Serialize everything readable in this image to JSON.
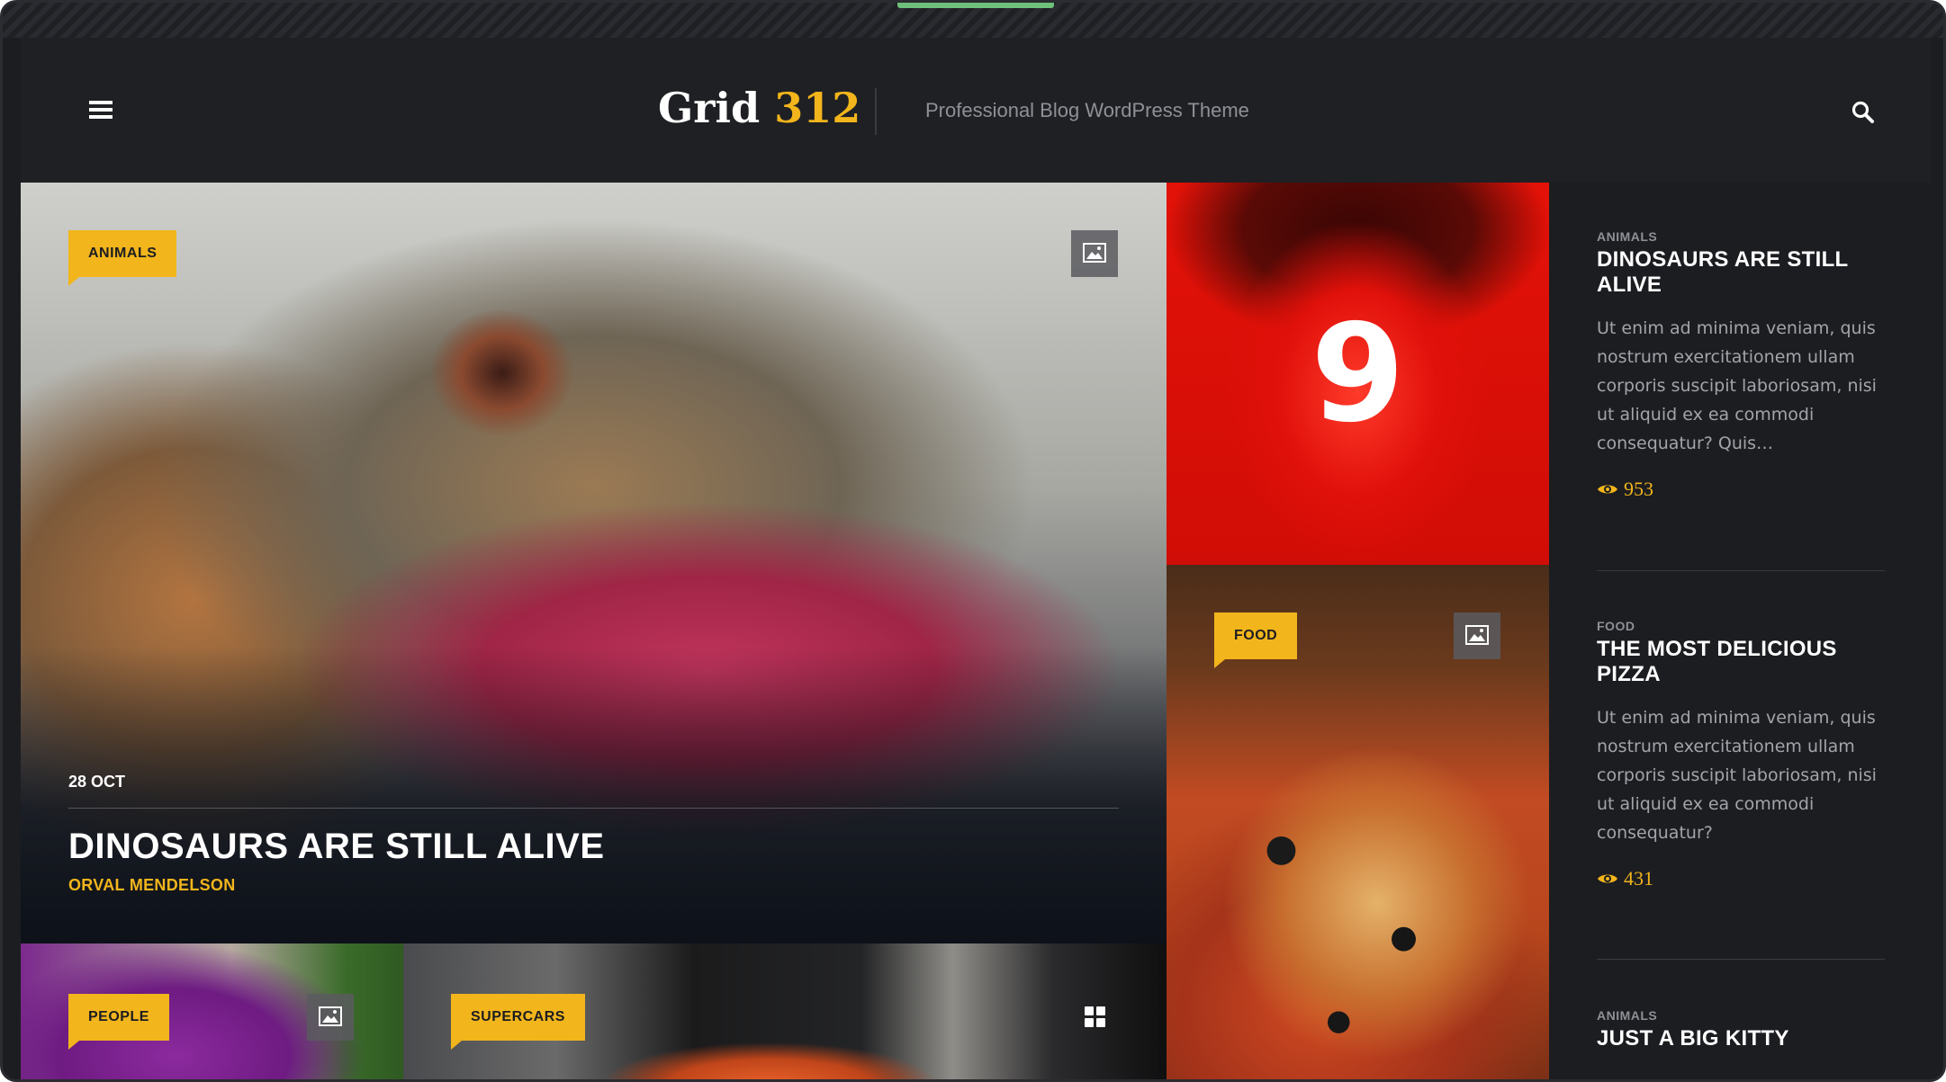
{
  "header": {
    "logo_word": "Grid",
    "logo_number": "312",
    "tagline": "Professional Blog WordPress Theme"
  },
  "hero": {
    "category": "ANIMALS",
    "date": "28 OCT",
    "title": "DINOSAURS ARE STILL ALIVE",
    "author": "ORVAL MENDELSON"
  },
  "tiles": {
    "red_number": "9",
    "food_category": "FOOD",
    "people_category": "PEOPLE",
    "cars_category": "SUPERCARS"
  },
  "sidebar": {
    "posts": [
      {
        "category": "ANIMALS",
        "title": "DINOSAURS ARE STILL ALIVE",
        "excerpt": "Ut enim ad minima veniam, quis nostrum exercitationem ullam corporis suscipit laboriosam, nisi ut aliquid ex ea commodi consequatur? Quis…",
        "views": "953"
      },
      {
        "category": "FOOD",
        "title": "THE MOST DELICIOUS PIZZA",
        "excerpt": "Ut enim ad minima veniam, quis nostrum exercitationem ullam corporis suscipit laboriosam, nisi ut aliquid ex ea commodi consequatur?",
        "views": "431"
      },
      {
        "category": "ANIMALS",
        "title": "JUST A BIG KITTY"
      }
    ]
  },
  "icons": {
    "menu": "hamburger-icon",
    "search": "search-icon",
    "image": "image-icon",
    "grid": "grid-icon",
    "views": "eye-icon"
  },
  "colors": {
    "accent": "#f2b51c",
    "background": "#1c1d21",
    "header": "#1f2024"
  }
}
